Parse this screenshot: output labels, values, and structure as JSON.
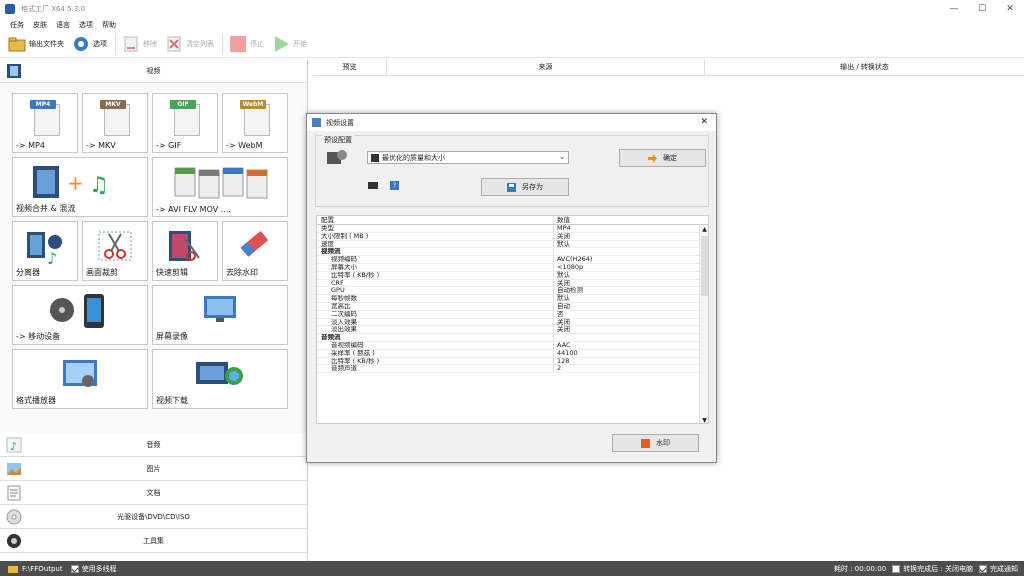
{
  "window": {
    "title": "格式工厂 X64 5.3.0",
    "minimize": "—",
    "maximize": "☐",
    "close": "✕"
  },
  "menu": [
    "任务",
    "皮肤",
    "语言",
    "选项",
    "帮助"
  ],
  "toolbar": {
    "output_folder": "输出文件夹",
    "options": "选项",
    "remove": "移除",
    "clear_list": "清空列表",
    "stop": "停止",
    "start": "开始"
  },
  "left": {
    "video_header": "视频",
    "tiles": [
      {
        "label": "-> MP4",
        "tag": "MP4",
        "tag_color": "#3b78c4"
      },
      {
        "label": "-> MKV",
        "tag": "MKV",
        "tag_color": "#8a6a50"
      },
      {
        "label": "-> GIF",
        "tag": "GIF",
        "tag_color": "#4aa35a"
      },
      {
        "label": "-> WebM",
        "tag": "WebM",
        "tag_color": "#b8873a"
      },
      {
        "label": "视频合并 & 混流"
      },
      {
        "label": "-> AVI FLV MOV ...."
      },
      {
        "label": "分离器"
      },
      {
        "label": "画面裁剪"
      },
      {
        "label": "快速剪辑"
      },
      {
        "label": "去除水印"
      },
      {
        "label": "-> 移动设备"
      },
      {
        "label": "屏幕录像"
      },
      {
        "label": "格式播放器"
      },
      {
        "label": "视频下载"
      }
    ],
    "categories": [
      "音频",
      "图片",
      "文档",
      "光驱设备\\DVD\\CD\\ISO",
      "工具集"
    ]
  },
  "right": {
    "col_preview": "预览",
    "col_source": "来源",
    "col_output": "输出 / 转换状态"
  },
  "dialog": {
    "title": "视频设置",
    "preset_legend": "预设配置",
    "preset_value": "最优化的质量和大小",
    "ok": "确定",
    "save_as": "另存为",
    "watermark": "水印",
    "table_header": {
      "key": "配置",
      "value": "数值"
    },
    "rows": [
      {
        "k": "类型",
        "v": "MP4",
        "t": "n"
      },
      {
        "k": "大小限制 ( MB )",
        "v": "关闭",
        "t": "n"
      },
      {
        "k": "速度",
        "v": "默认",
        "t": "n"
      },
      {
        "k": "视频流",
        "v": "",
        "t": "g"
      },
      {
        "k": "视频编码",
        "v": "AVC(H264)",
        "t": "s"
      },
      {
        "k": "屏幕大小",
        "v": "<1080p",
        "t": "s"
      },
      {
        "k": "比特率 ( KB/秒 )",
        "v": "默认",
        "t": "s"
      },
      {
        "k": "CRF",
        "v": "关闭",
        "t": "s"
      },
      {
        "k": "GPU",
        "v": "自动检测",
        "t": "s"
      },
      {
        "k": "每秒帧数",
        "v": "默认",
        "t": "s"
      },
      {
        "k": "宽高比",
        "v": "自动",
        "t": "s"
      },
      {
        "k": "二次编码",
        "v": "否",
        "t": "s"
      },
      {
        "k": "淡入效果",
        "v": "关闭",
        "t": "s"
      },
      {
        "k": "淡出效果",
        "v": "关闭",
        "t": "s"
      },
      {
        "k": "音频流",
        "v": "",
        "t": "g"
      },
      {
        "k": "音视频编码",
        "v": "AAC",
        "t": "s"
      },
      {
        "k": "采样率 ( 赫兹 )",
        "v": "44100",
        "t": "s"
      },
      {
        "k": "比特率 ( KB/秒 )",
        "v": "128",
        "t": "s"
      },
      {
        "k": "音频声道",
        "v": "2",
        "t": "s"
      }
    ]
  },
  "status": {
    "output_path": "F:\\FFOutput",
    "multithread": "使用多线程",
    "elapsed": "耗时 : 00:00:00",
    "after_convert": "转换完成后 : 关闭电脑",
    "notify": "完成通知"
  }
}
